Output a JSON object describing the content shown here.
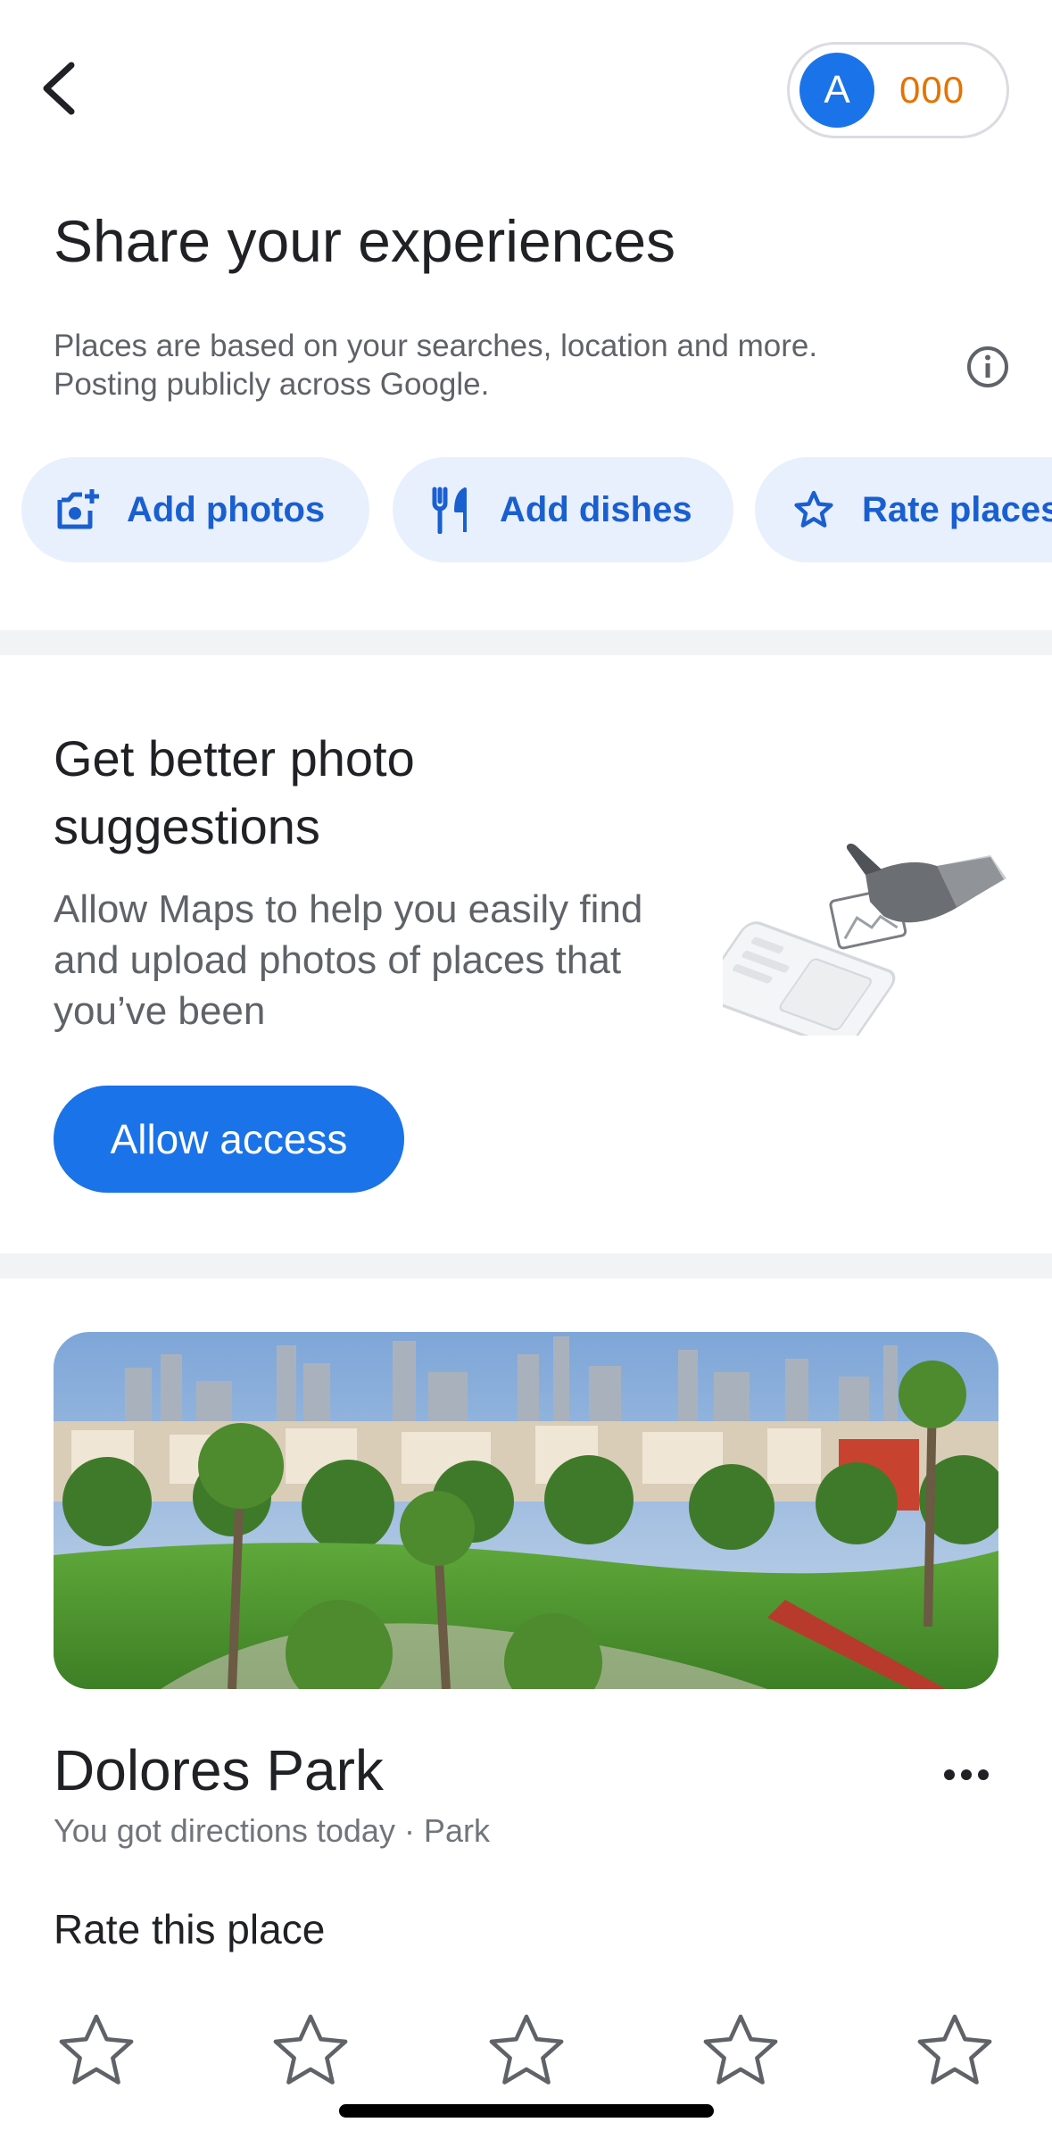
{
  "header": {
    "avatar_letter": "A",
    "points": "000"
  },
  "title": "Share your experiences",
  "subtitle": "Places are based on your searches, location and more. Posting publicly across Google.",
  "chips": [
    {
      "label": "Add photos",
      "icon": "add-photo-icon"
    },
    {
      "label": "Add dishes",
      "icon": "utensils-icon"
    },
    {
      "label": "Rate places",
      "icon": "star-outline-icon"
    }
  ],
  "suggestion": {
    "title": "Get better photo suggestions",
    "body": "Allow Maps to help you easily find and upload photos of places that you’ve been",
    "button_label": "Allow access"
  },
  "place": {
    "name": "Dolores Park",
    "meta": "You got directions today · Park",
    "rate_label": "Rate this place",
    "rating": 0,
    "max_rating": 5
  },
  "colors": {
    "accent": "#1a73e8",
    "chip_bg": "#e8f0fe",
    "points": "#e37400"
  }
}
